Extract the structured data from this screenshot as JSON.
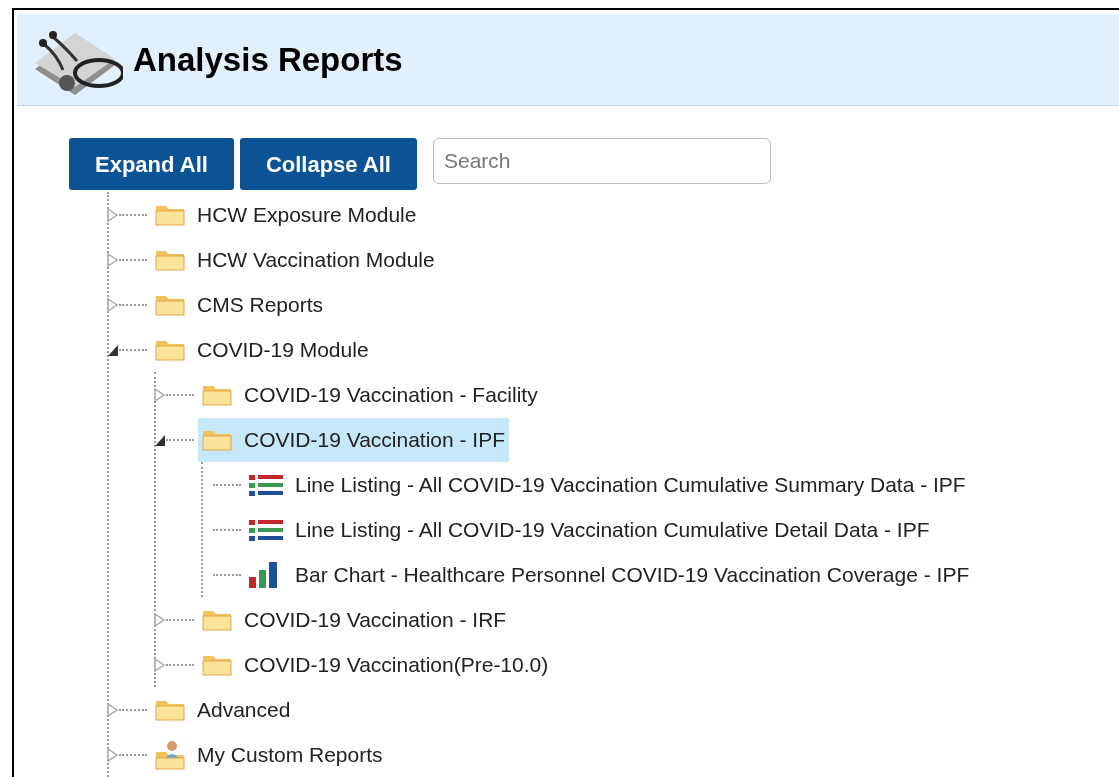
{
  "header": {
    "title": "Analysis Reports"
  },
  "buttons": [
    "Expand All",
    "Collapse All"
  ],
  "search": {
    "placeholder": "Search"
  },
  "tree": [
    {
      "label": "HCW Exposure Module",
      "kind": "folder",
      "expanded": false,
      "selected": false
    },
    {
      "label": "HCW Vaccination Module",
      "kind": "folder",
      "expanded": false,
      "selected": false
    },
    {
      "label": "CMS Reports",
      "kind": "folder",
      "expanded": false,
      "selected": false
    },
    {
      "label": "COVID-19 Module",
      "kind": "folder",
      "expanded": true,
      "selected": false,
      "children": [
        {
          "label": "COVID-19 Vaccination - Facility",
          "kind": "folder",
          "expanded": false,
          "selected": false
        },
        {
          "label": "COVID-19 Vaccination - IPF",
          "kind": "folder",
          "expanded": true,
          "selected": true,
          "children": [
            {
              "label": "Line Listing - All COVID-19 Vaccination Cumulative Summary Data - IPF",
              "kind": "listing",
              "selected": false
            },
            {
              "label": "Line Listing - All COVID-19 Vaccination Cumulative Detail Data - IPF",
              "kind": "listing",
              "selected": false
            },
            {
              "label": "Bar Chart - Healthcare Personnel COVID-19 Vaccination Coverage - IPF",
              "kind": "barchart",
              "selected": false
            }
          ]
        },
        {
          "label": "COVID-19 Vaccination - IRF",
          "kind": "folder",
          "expanded": false,
          "selected": false
        },
        {
          "label": "COVID-19 Vaccination(Pre-10.0)",
          "kind": "folder",
          "expanded": false,
          "selected": false
        }
      ]
    },
    {
      "label": "Advanced",
      "kind": "folder",
      "expanded": false,
      "selected": false
    },
    {
      "label": "My Custom Reports",
      "kind": "custom",
      "expanded": false,
      "selected": false
    }
  ]
}
